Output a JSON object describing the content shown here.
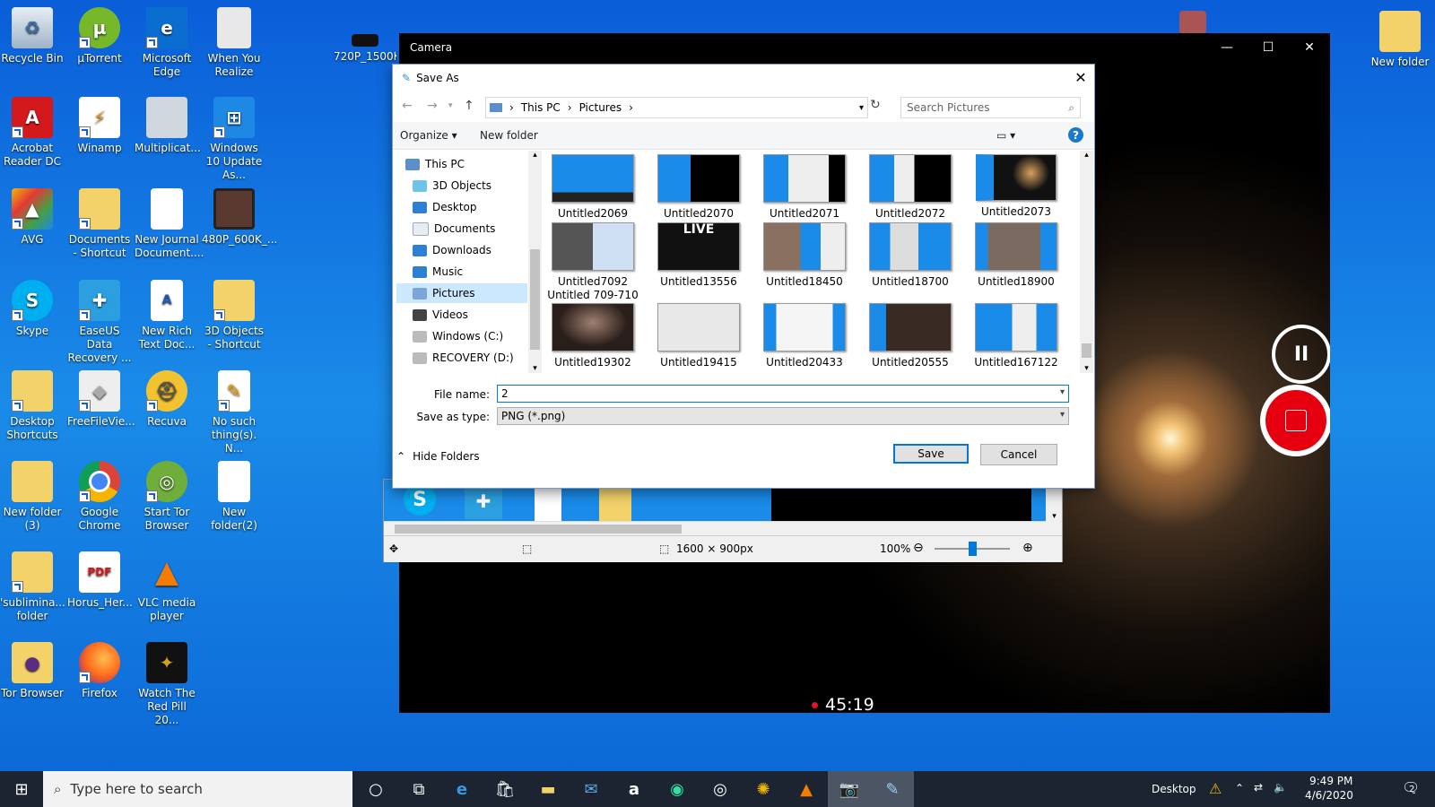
{
  "desktop": {
    "col1": [
      "Recycle Bin",
      "Acrobat Reader DC",
      "AVG",
      "Skype",
      "Desktop Shortcuts",
      "New folder (3)",
      "'sublimina... folder",
      "Tor Browser"
    ],
    "col2": [
      "µTorrent",
      "Winamp",
      "Documents - Shortcut",
      "EaseUS Data Recovery ...",
      "FreeFileVie...",
      "Google Chrome",
      "Horus_Her...",
      "Firefox"
    ],
    "col3": [
      "Microsoft Edge",
      "Multiplicat...",
      "New Journal Document....",
      "New Rich Text Doc...",
      "Recuva",
      "Start Tor Browser",
      "VLC media player",
      "Watch The Red Pill 20..."
    ],
    "col4": [
      "When You Realize",
      "Windows 10 Update As...",
      "480P_600K_...",
      "3D Objects - Shortcut",
      "No such thing(s). N...",
      "New folder(2)"
    ],
    "floating": "720P_1500K",
    "right": "New folder"
  },
  "camera": {
    "title": "Camera",
    "minimize": "—",
    "maximize": "☐",
    "close": "✕",
    "pause_icon": "II",
    "timer": "45:19"
  },
  "saveas": {
    "title": "Save As",
    "close": "✕",
    "back": "←",
    "forward": "→",
    "up": "↑",
    "breadcrumb": [
      "This PC",
      "Pictures"
    ],
    "refresh": "↻",
    "search_placeholder": "Search Pictures",
    "organize": "Organize ▾",
    "new_folder": "New folder",
    "help": "?",
    "nav": [
      "This PC",
      "3D Objects",
      "Desktop",
      "Documents",
      "Downloads",
      "Music",
      "Pictures",
      "Videos",
      "Windows (C:)",
      "RECOVERY (D:)"
    ],
    "files": [
      {
        "name": "Untitled2069"
      },
      {
        "name": "Untitled2070"
      },
      {
        "name": "Untitled2071"
      },
      {
        "name": "Untitled2072"
      },
      {
        "name": "Untitled2073"
      },
      {
        "name": "Untitled7092 Untitled 709-710"
      },
      {
        "name": "Untitled13556"
      },
      {
        "name": "Untitled18450"
      },
      {
        "name": "Untitled18700"
      },
      {
        "name": "Untitled18900"
      },
      {
        "name": "Untitled19302"
      },
      {
        "name": "Untitled19415"
      },
      {
        "name": "Untitled20433"
      },
      {
        "name": "Untitled20555"
      },
      {
        "name": "Untitled167122"
      }
    ],
    "filename_label": "File name:",
    "filename_value": "2",
    "type_label": "Save as type:",
    "type_value": "PNG (*.png)",
    "hide_folders": "Hide Folders",
    "save": "Save",
    "cancel": "Cancel"
  },
  "paint": {
    "dimensions": "1600 × 900px",
    "zoom": "100%",
    "zoom_fraction": 0.5
  },
  "taskbar": {
    "search_placeholder": "Type here to search",
    "desktop_label": "Desktop",
    "time": "9:49 PM",
    "date": "4/6/2020",
    "notifications": "2"
  }
}
